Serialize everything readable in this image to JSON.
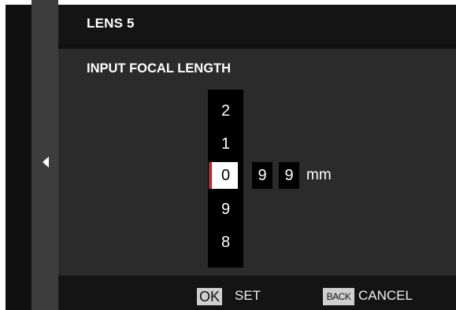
{
  "header": {
    "title": "LENS 5"
  },
  "dialog": {
    "subtitle": "INPUT FOCAL LENGTH",
    "picker": {
      "above": [
        "2",
        "1"
      ],
      "selected": "0",
      "below": [
        "9",
        "8"
      ]
    },
    "trailing_digits": [
      "9",
      "9"
    ],
    "unit": "mm"
  },
  "footer": {
    "ok_key": "OK",
    "ok_label": "SET",
    "back_key": "BACK",
    "back_label": "CANCEL"
  },
  "icons": {
    "side": "triangle-left-icon"
  },
  "colors": {
    "selection_accent": "#c8202a"
  }
}
